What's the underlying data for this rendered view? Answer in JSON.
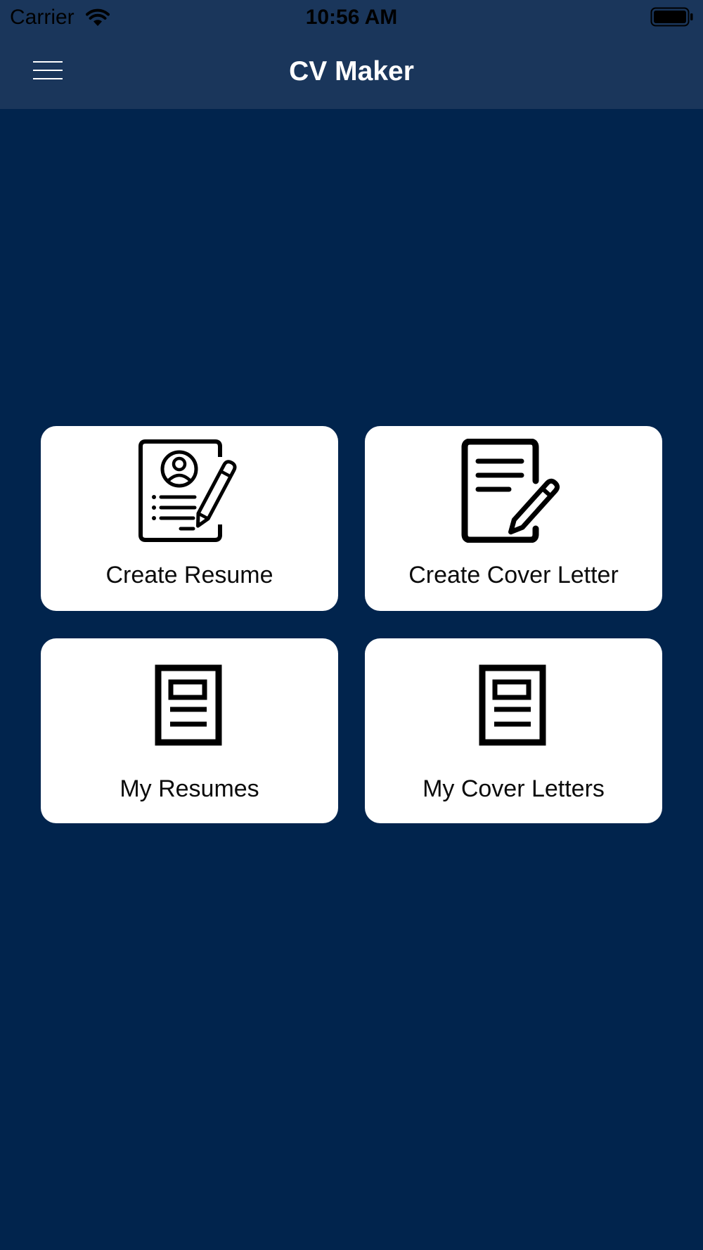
{
  "status_bar": {
    "carrier": "Carrier",
    "time": "10:56 AM",
    "wifi_icon": "wifi-icon",
    "battery_icon": "battery-full-icon"
  },
  "nav_bar": {
    "title": "CV Maker",
    "menu_icon": "hamburger-menu-icon"
  },
  "actions": [
    {
      "label": "Create Resume",
      "icon": "resume-edit-icon"
    },
    {
      "label": "Create Cover Letter",
      "icon": "letter-edit-icon"
    },
    {
      "label": "My Resumes",
      "icon": "document-icon"
    },
    {
      "label": "My Cover Letters",
      "icon": "document-icon"
    }
  ],
  "colors": {
    "background": "#01244d",
    "bar": "#1a365b",
    "card": "#ffffff",
    "icon": "#000000"
  }
}
